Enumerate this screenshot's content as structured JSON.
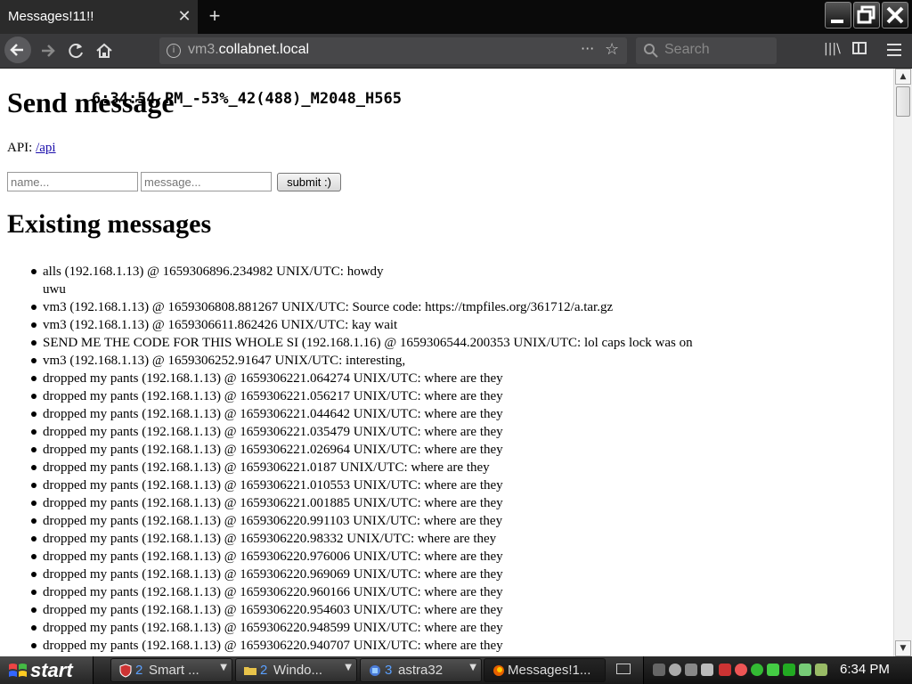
{
  "browser": {
    "tab_title": "Messages!11!!",
    "tab_close_glyph": "✕",
    "new_tab_glyph": "+",
    "url_prefix": "vm3.",
    "url_domain": "collabnet.local",
    "page_actions_glyph": "···",
    "bookmark_glyph": "☆",
    "search_placeholder": "Search",
    "icons": [
      "back-arrow-icon",
      "forward-arrow-icon",
      "reload-icon",
      "home-icon",
      "site-info-icon",
      "bookmark-star-icon",
      "search-icon",
      "library-icon",
      "sidebar-icon",
      "hamburger-menu-icon"
    ]
  },
  "page": {
    "send_heading": "Send message",
    "overlay_stats": "6:34:54 PM_-53%_42(488)_M2048_H565",
    "api_label": "API: ",
    "api_link": "/api",
    "name_placeholder": "name...",
    "message_placeholder": "message...",
    "submit_label": "submit :)",
    "existing_heading": "Existing messages",
    "messages": [
      "alls (192.168.1.13) @ 1659306896.234982 UNIX/UTC: howdy\nuwu",
      "vm3 (192.168.1.13) @ 1659306808.881267 UNIX/UTC: Source code: https://tmpfiles.org/361712/a.tar.gz",
      "vm3 (192.168.1.13) @ 1659306611.862426 UNIX/UTC: kay wait",
      "SEND ME THE CODE FOR THIS WHOLE SI (192.168.1.16) @ 1659306544.200353 UNIX/UTC: lol caps lock was on",
      "vm3 (192.168.1.13) @ 1659306252.91647 UNIX/UTC: interesting,",
      "dropped my pants (192.168.1.13) @ 1659306221.064274 UNIX/UTC: where are they",
      "dropped my pants (192.168.1.13) @ 1659306221.056217 UNIX/UTC: where are they",
      "dropped my pants (192.168.1.13) @ 1659306221.044642 UNIX/UTC: where are they",
      "dropped my pants (192.168.1.13) @ 1659306221.035479 UNIX/UTC: where are they",
      "dropped my pants (192.168.1.13) @ 1659306221.026964 UNIX/UTC: where are they",
      "dropped my pants (192.168.1.13) @ 1659306221.0187 UNIX/UTC: where are they",
      "dropped my pants (192.168.1.13) @ 1659306221.010553 UNIX/UTC: where are they",
      "dropped my pants (192.168.1.13) @ 1659306221.001885 UNIX/UTC: where are they",
      "dropped my pants (192.168.1.13) @ 1659306220.991103 UNIX/UTC: where are they",
      "dropped my pants (192.168.1.13) @ 1659306220.98332 UNIX/UTC: where are they",
      "dropped my pants (192.168.1.13) @ 1659306220.976006 UNIX/UTC: where are they",
      "dropped my pants (192.168.1.13) @ 1659306220.969069 UNIX/UTC: where are they",
      "dropped my pants (192.168.1.13) @ 1659306220.960166 UNIX/UTC: where are they",
      "dropped my pants (192.168.1.13) @ 1659306220.954603 UNIX/UTC: where are they",
      "dropped my pants (192.168.1.13) @ 1659306220.948599 UNIX/UTC: where are they",
      "dropped my pants (192.168.1.13) @ 1659306220.940707 UNIX/UTC: where are they"
    ]
  },
  "taskbar": {
    "start_label": "start",
    "tasks": [
      {
        "count": "2",
        "label": "Smart ...",
        "icon": "shield-icon"
      },
      {
        "count": "2",
        "label": "Windo...",
        "icon": "folder-icon"
      },
      {
        "count": "3",
        "label": "astra32",
        "icon": "chip-icon"
      },
      {
        "count": "",
        "label": "Messages!1...",
        "icon": "firefox-icon"
      }
    ],
    "clock": "6:34 PM"
  },
  "colors": {
    "tab_bg": "#2b2b2b",
    "toolbar_bg": "#3a3a3c",
    "link": "#1a0dab",
    "taskbar_bg": "#1a1a1a"
  }
}
